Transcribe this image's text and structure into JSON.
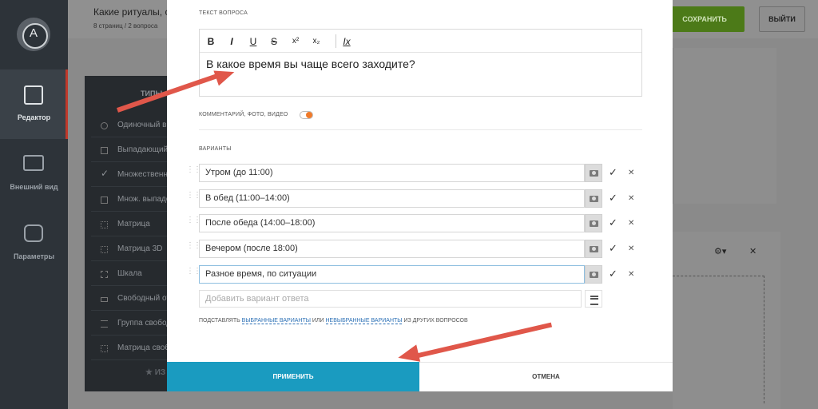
{
  "app": {
    "logo_letter": "A",
    "accent": "#1a9bc0",
    "save_color": "#6aa220",
    "arrow_color": "#e0574a"
  },
  "nav": [
    {
      "label": "Редактор",
      "icon": "edit-icon",
      "active": true
    },
    {
      "label": "Внешний вид",
      "icon": "monitor-icon",
      "active": false
    },
    {
      "label": "Параметры",
      "icon": "toggles-icon",
      "active": false
    }
  ],
  "header": {
    "title": "Какие ритуалы, со",
    "subtitle": "8 страниц / 2 вопроса",
    "save_label": "СОХРАНИТЬ",
    "exit_label": "ВЫЙТИ"
  },
  "types_panel": {
    "heading": "ТИПЫ",
    "items": [
      {
        "label": "Одиночный вы",
        "icon": "radio-icon"
      },
      {
        "label": "Выпадающий",
        "icon": "dropdown-icon"
      },
      {
        "label": "Множественн",
        "icon": "check-icon"
      },
      {
        "label": "Множ. выпадо",
        "icon": "dropdown-icon"
      },
      {
        "label": "Матрица",
        "icon": "matrix-icon"
      },
      {
        "label": "Матрица 3D",
        "icon": "matrix-3d-icon"
      },
      {
        "label": "Шкала",
        "icon": "scale-icon"
      },
      {
        "label": "Свободный от",
        "icon": "text-icon"
      },
      {
        "label": "Группа свобод",
        "icon": "list-icon"
      },
      {
        "label": "Матрица своб",
        "icon": "matrix-icon"
      }
    ],
    "footer": "★ ИЗ"
  },
  "modal": {
    "question_label": "ТЕКСТ ВОПРОСА",
    "question_text": "В какое время вы чаще всего заходите?",
    "toolbar": [
      "B",
      "I",
      "U",
      "S",
      "x²",
      "x₂",
      "Ix"
    ],
    "comment_label": "КОММЕНТАРИЙ, ФОТО, ВИДЕО",
    "comment_enabled": true,
    "options_label": "ВАРИАНТЫ",
    "options": [
      "Утром (до 11:00)",
      "В обед (11:00–14:00)",
      "После обеда (14:00–18:00)",
      "Вечером (после 18:00)",
      "Разное время, по ситуации"
    ],
    "add_placeholder": "Добавить вариант ответа",
    "substitute": {
      "prefix": "ПОДСТАВЛЯТЬ",
      "link1": "ВЫБРАННЫЕ ВАРИАНТЫ",
      "or": "ИЛИ",
      "link2": "НЕВЫБРАННЫЕ ВАРИАНТЫ",
      "suffix": "ИЗ ДРУГИХ ВОПРОСОВ"
    },
    "apply_label": "ПРИМЕНИТЬ",
    "cancel_label": "ОТМЕНА"
  }
}
